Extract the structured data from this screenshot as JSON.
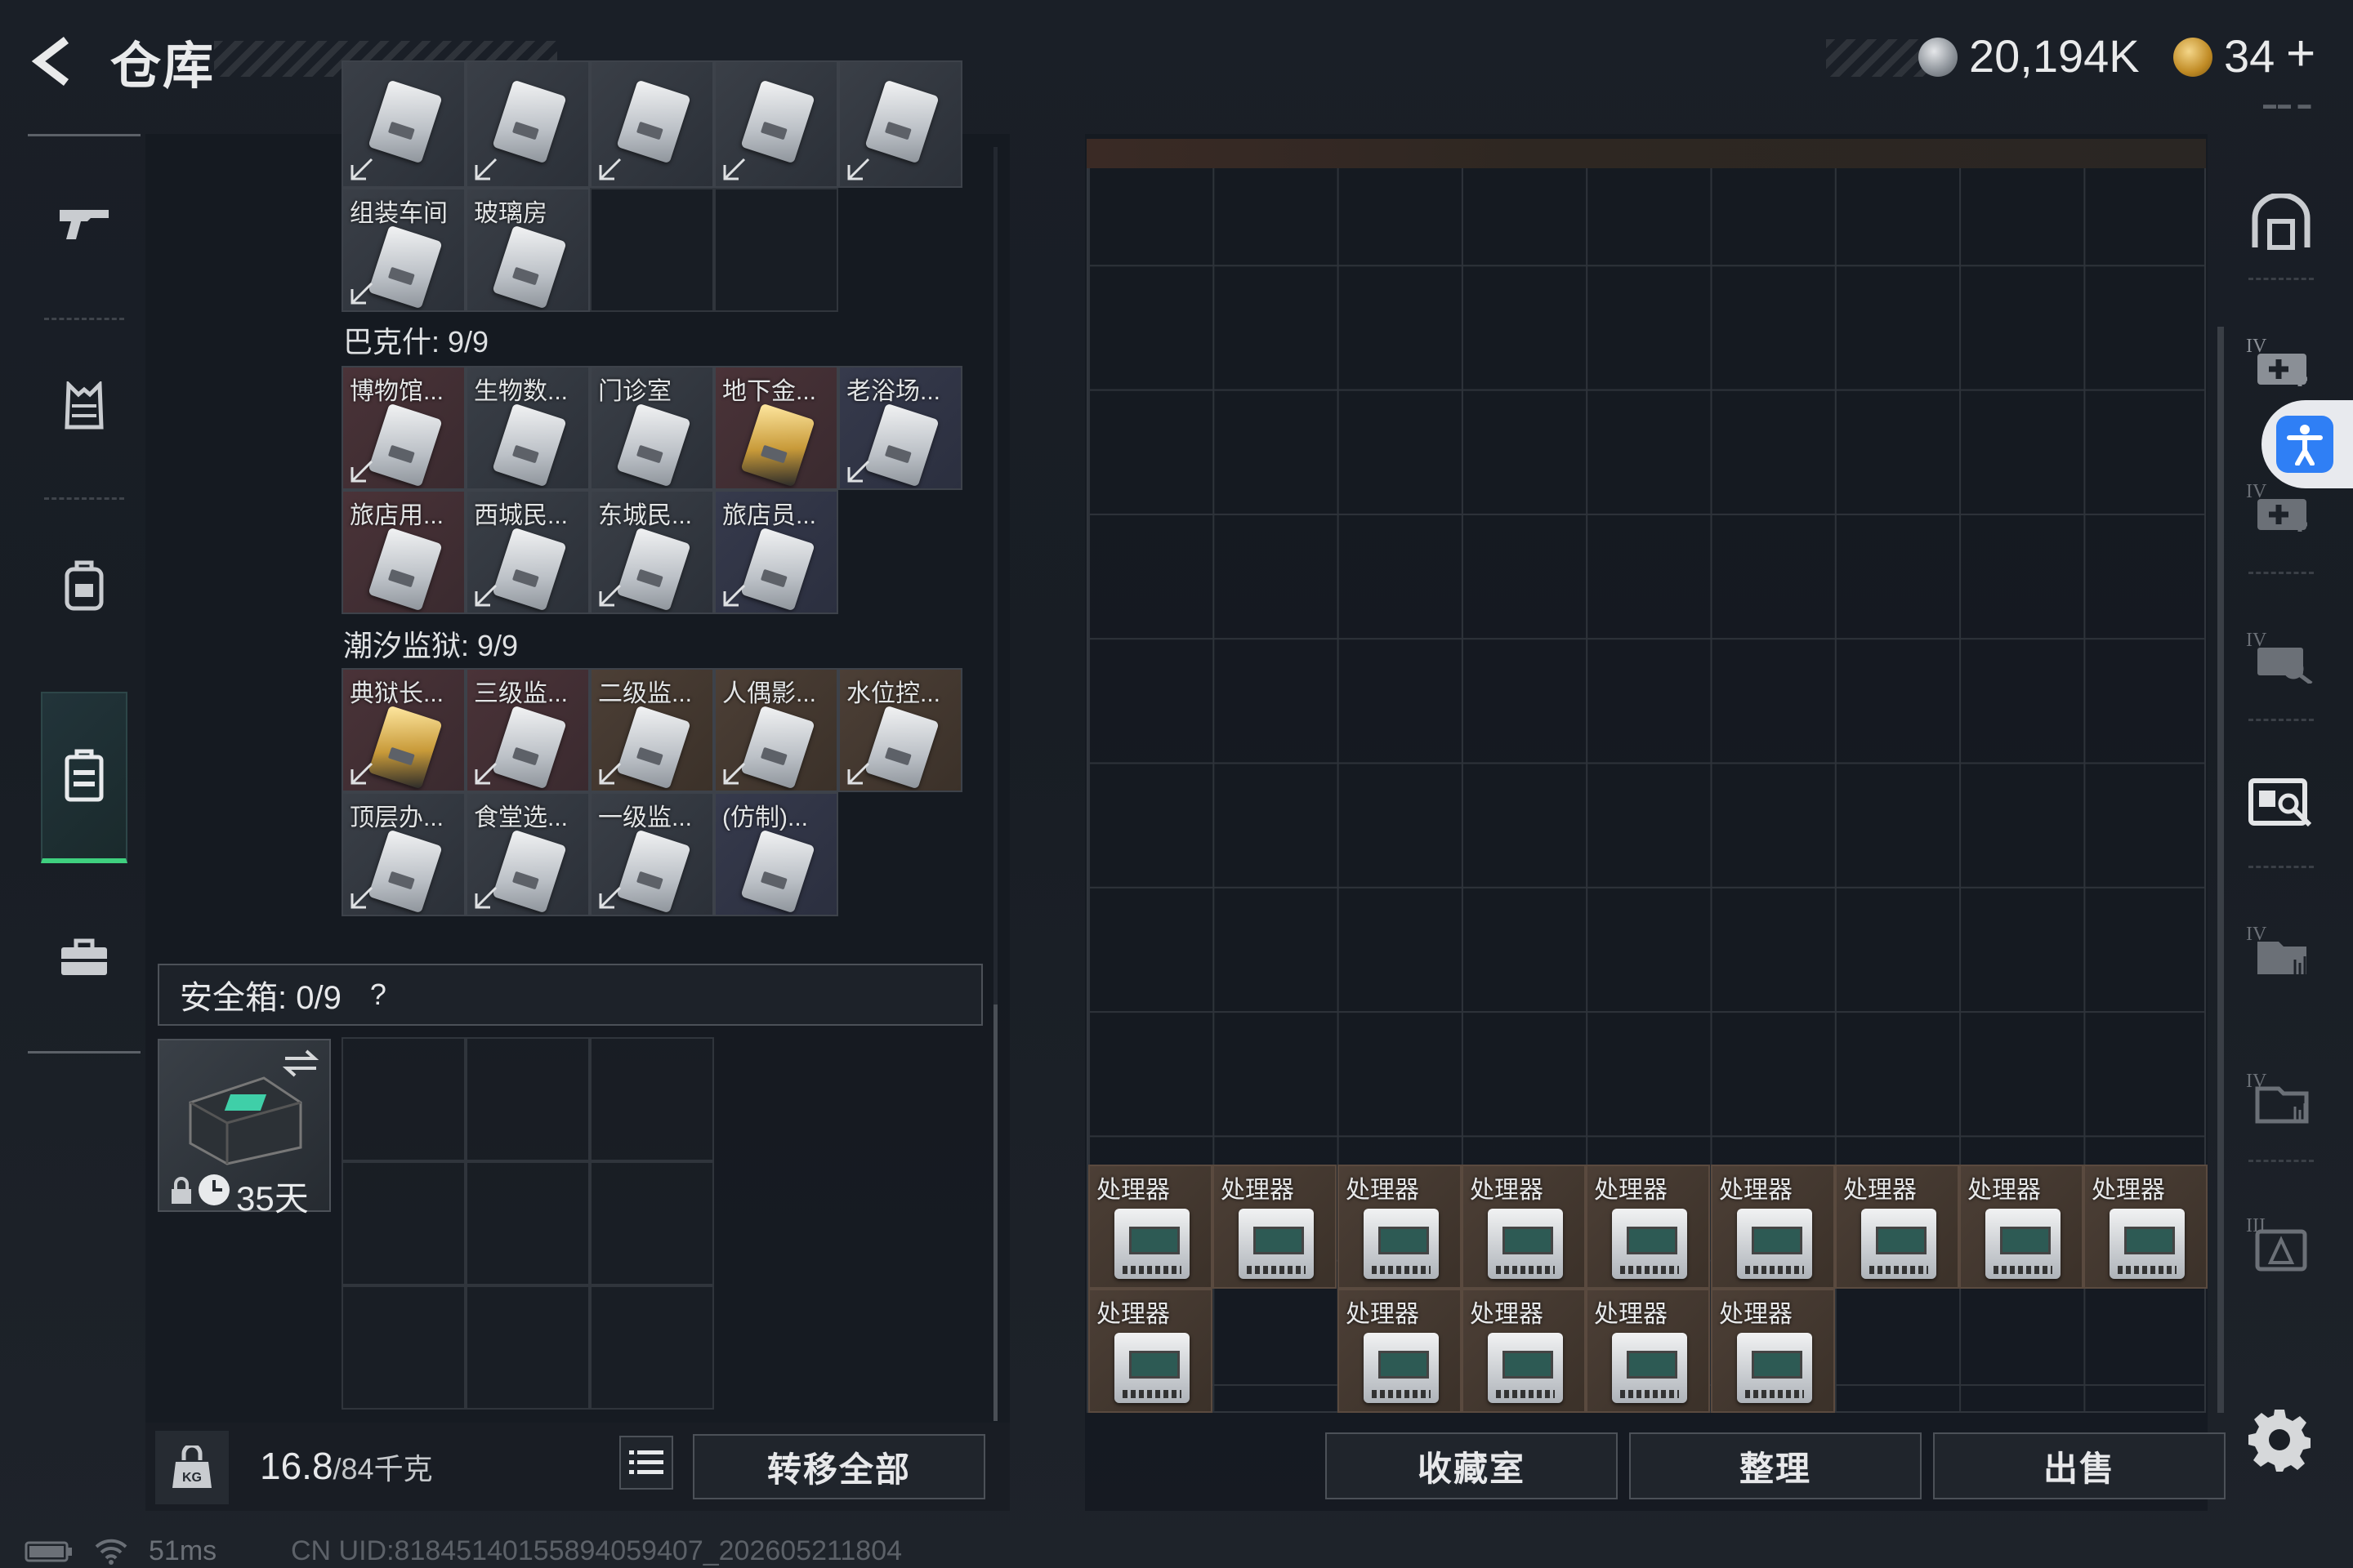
{
  "header": {
    "title": "仓库",
    "currency1": "20,194K",
    "currency2": "34",
    "plus": "+",
    "tag": "▬▬ ▬"
  },
  "left_nav": [
    {
      "icon": "rifle-icon"
    },
    {
      "icon": "armor-vest-icon"
    },
    {
      "icon": "backpack-icon"
    },
    {
      "icon": "container-icon",
      "active": true
    },
    {
      "icon": "briefcase-icon"
    }
  ],
  "sections": [
    {
      "items": [
        {
          "label": "",
          "bg": "gray"
        },
        {
          "label": "",
          "bg": "gray"
        },
        {
          "label": "",
          "bg": "gray"
        },
        {
          "label": "",
          "bg": "gray"
        },
        {
          "label": "",
          "bg": "gray"
        },
        {
          "label": "组装车间",
          "bg": "gray"
        },
        {
          "label": "玻璃房",
          "bg": "gray"
        }
      ]
    },
    {
      "title": "巴克什: 9/9",
      "items": [
        {
          "label": "博物馆...",
          "bg": "red"
        },
        {
          "label": "生物数...",
          "bg": "gray"
        },
        {
          "label": "门诊室",
          "bg": "gray"
        },
        {
          "label": "地下金...",
          "bg": "red",
          "gold": true
        },
        {
          "label": "老浴场...",
          "bg": "purple"
        },
        {
          "label": "旅店用...",
          "bg": "red"
        },
        {
          "label": "西城民...",
          "bg": "gray"
        },
        {
          "label": "东城民...",
          "bg": "gray"
        },
        {
          "label": "旅店员...",
          "bg": "purple"
        }
      ]
    },
    {
      "title": "潮汐监狱: 9/9",
      "items": [
        {
          "label": "典狱长...",
          "bg": "red",
          "gold": true
        },
        {
          "label": "三级监...",
          "bg": "red"
        },
        {
          "label": "二级监...",
          "bg": "brown"
        },
        {
          "label": "人偶影...",
          "bg": "brown"
        },
        {
          "label": "水位控...",
          "bg": "brown"
        },
        {
          "label": "顶层办...",
          "bg": "gray"
        },
        {
          "label": "食堂选...",
          "bg": "gray"
        },
        {
          "label": "一级监...",
          "bg": "gray"
        },
        {
          "label": "(仿制)...",
          "bg": "purple"
        }
      ]
    }
  ],
  "safe_box": {
    "label": "安全箱: 0/9",
    "help": "?",
    "days": "35天"
  },
  "footer_left": {
    "weight": "16.8",
    "capacity": "/84千克",
    "kg_icon": "KG",
    "transfer": "转移全部"
  },
  "stash": {
    "processor_label": "处理器",
    "row1_count": 9,
    "row2_slots": [
      1,
      3,
      4,
      5,
      6
    ]
  },
  "footer_right": {
    "buttons": [
      "收藏室",
      "整理",
      "出售"
    ]
  },
  "right_nav": [
    {
      "icon": "vault-icon"
    },
    {
      "icon": "medical-case-icon",
      "tier": "IV"
    },
    {
      "icon": "medical-case-plus-icon",
      "tier": "IV"
    },
    {
      "icon": "key-case-icon",
      "tier": "IV"
    },
    {
      "icon": "card-case-icon",
      "tier": ""
    },
    {
      "icon": "document-case-icon",
      "tier": "IV"
    },
    {
      "icon": "folder-case-icon",
      "tier": "IV"
    },
    {
      "icon": "ammo-case-icon",
      "tier": "III"
    }
  ],
  "status": {
    "ping": "51ms",
    "uid": "CN UID:81845140155894059407_202605211804"
  },
  "colors": {
    "active_green": "#3fd07f",
    "accessibility_blue": "#2f7ff5"
  }
}
